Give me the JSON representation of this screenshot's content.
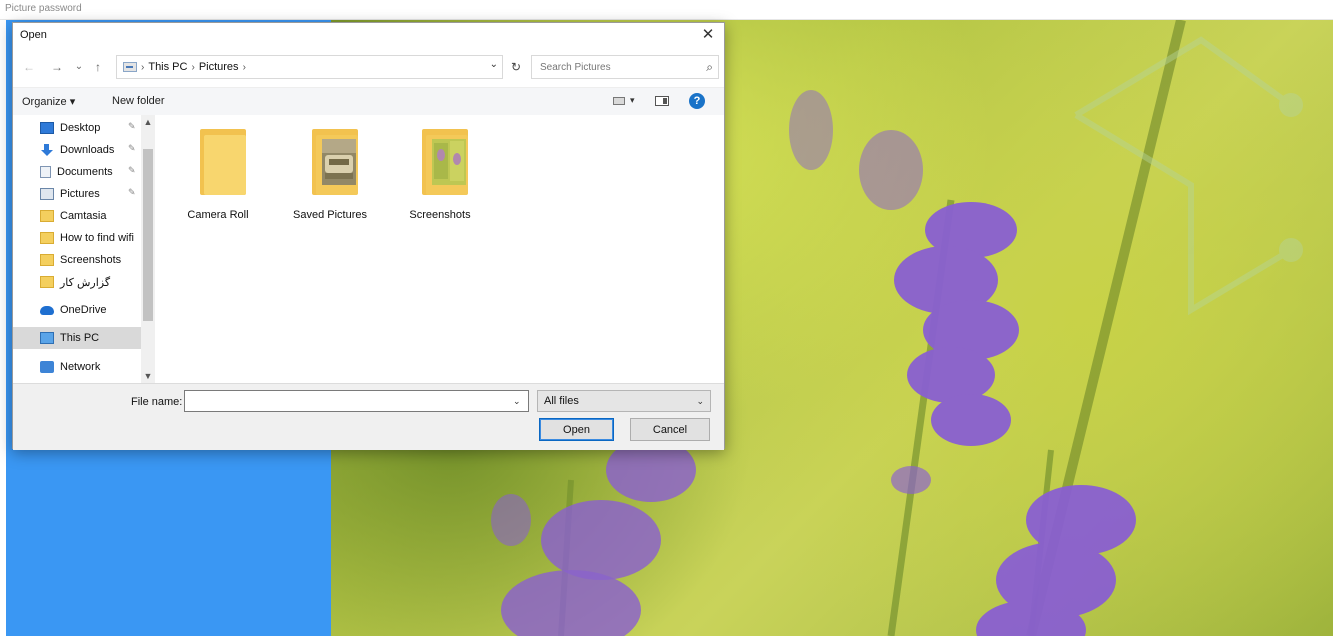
{
  "window": {
    "title": "Picture password"
  },
  "dialog": {
    "title": "Open",
    "close_glyph": "✕",
    "nav": {
      "back_glyph": "←",
      "forward_glyph": "→",
      "recent_glyph": "⌄",
      "up_glyph": "↑",
      "breadcrumbs": [
        "This PC",
        "Pictures"
      ],
      "crumb_sep": "›",
      "dropdown_glyph": "⌄",
      "refresh_glyph": "↻",
      "search_placeholder": "Search Pictures",
      "search_glyph": "⌕"
    },
    "toolbar": {
      "organize": "Organize ▾",
      "new_folder": "New folder",
      "view_dd": "▾",
      "help": "?"
    },
    "sidebar": {
      "items": [
        {
          "label": "Desktop",
          "icon": "desktop-icon",
          "pinned": true
        },
        {
          "label": "Downloads",
          "icon": "downloads-icon",
          "pinned": true
        },
        {
          "label": "Documents",
          "icon": "documents-icon",
          "pinned": true
        },
        {
          "label": "Pictures",
          "icon": "pictures-icon",
          "pinned": true
        },
        {
          "label": "Camtasia",
          "icon": "folder-icon",
          "pinned": false
        },
        {
          "label": "How to find wifi",
          "icon": "folder-icon",
          "pinned": false
        },
        {
          "label": "Screenshots",
          "icon": "folder-icon",
          "pinned": false
        },
        {
          "label": "گزارش کار",
          "icon": "folder-icon",
          "pinned": false
        },
        {
          "label": "OneDrive",
          "icon": "onedrive-icon",
          "pinned": false
        },
        {
          "label": "This PC",
          "icon": "this-pc-icon",
          "pinned": false,
          "selected": true
        },
        {
          "label": "Network",
          "icon": "network-icon",
          "pinned": false
        }
      ],
      "pin_glyph": "📌"
    },
    "folders": [
      {
        "name": "Camera Roll",
        "thumb": "none"
      },
      {
        "name": "Saved Pictures",
        "thumb": "car-photo"
      },
      {
        "name": "Screenshots",
        "thumb": "screenshot-images"
      }
    ],
    "footer": {
      "file_name_label": "File name:",
      "file_name_value": "",
      "file_name_dd": "⌄",
      "file_type": "All files",
      "file_type_dd": "⌄",
      "open_label": "Open",
      "cancel_label": "Cancel"
    }
  },
  "colors": {
    "accent": "#3a97f3",
    "folder": "#f8d66e",
    "selection": "#d9d9d9"
  }
}
